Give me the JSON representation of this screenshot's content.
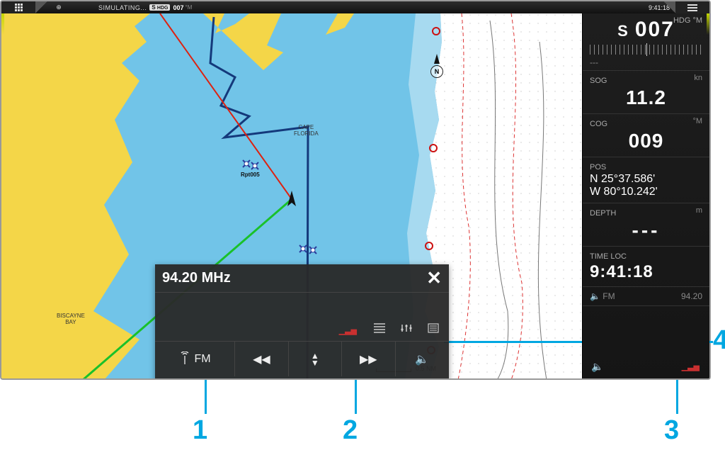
{
  "topbar": {
    "status": "SIMULATING...",
    "hdg_prefix": "S",
    "hdg_prefix_label": "HDG",
    "hdg_value": "007",
    "hdg_unit": "°M",
    "clock": "9:41:18"
  },
  "chart": {
    "labels": {
      "cape": "CAPE\nFLORIDA",
      "bay": "BISCAYNE\nBAY"
    },
    "waypoint": "Rpt005",
    "compass_letter": "N",
    "scale": "0.5 NM"
  },
  "instruments": {
    "hdg": {
      "unit_lbl": "HDG  °M",
      "dir": "S",
      "value": "007",
      "dash": "---"
    },
    "sog": {
      "label": "SOG",
      "unit": "kn",
      "value": "11.2"
    },
    "cog": {
      "label": "COG",
      "unit": "°M",
      "value": "009"
    },
    "pos": {
      "label": "POS",
      "lat": "N  25°37.586'",
      "lon": "W 80°10.242'"
    },
    "depth": {
      "label": "DEPTH",
      "unit": "m",
      "value": "---"
    },
    "time": {
      "label": "TIME LOC",
      "value": "9:41:18"
    },
    "fm_mini": {
      "band": "FM",
      "freq": "94.20"
    }
  },
  "audio": {
    "frequency": "94.20 MHz",
    "source_label": "FM"
  },
  "callouts": {
    "c1": "1",
    "c2": "2",
    "c3": "3",
    "c4": "4"
  }
}
